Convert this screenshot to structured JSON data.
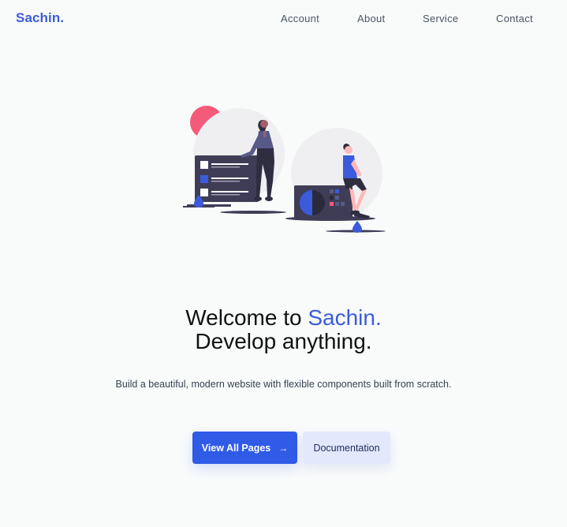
{
  "navbar": {
    "logo": "Sachin.",
    "links": [
      {
        "label": "Account"
      },
      {
        "label": "About"
      },
      {
        "label": "Service"
      },
      {
        "label": "Contact"
      }
    ]
  },
  "hero": {
    "headline_prefix": "Welcome to ",
    "headline_accent": "Sachin.",
    "headline_line2": "Develop anything.",
    "subtext": "Build a beautiful, modern website with flexible components built from scratch.",
    "primary_button": {
      "label": "View All Pages",
      "icon": "arrow-right-icon"
    },
    "secondary_button": {
      "label": "Documentation"
    }
  },
  "colors": {
    "accent": "#3b5bdb",
    "primary_button": "#2f5be7",
    "secondary_button": "#e3e8fd",
    "background": "#f9fbfb"
  }
}
